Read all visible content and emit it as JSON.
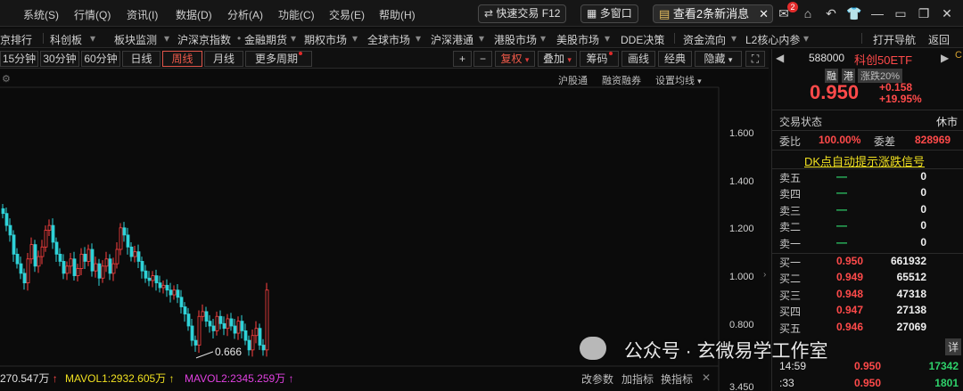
{
  "menubar": {
    "items": [
      "系统(S)",
      "行情(Q)",
      "资讯(I)",
      "数据(D)",
      "分析(A)",
      "功能(C)",
      "交易(E)",
      "帮助(H)"
    ],
    "quick_trade": "快速交易 F12",
    "multi_window": "多窗口",
    "news": "查看2条新消息",
    "mail_badge": "2"
  },
  "navbar": {
    "items": [
      "京排行",
      "科创板",
      "板块监测",
      "沪深京指数",
      "金融期货",
      "期权市场",
      "全球市场",
      "沪深港通",
      "港股市场",
      "美股市场",
      "DDE决策",
      "资金流向",
      "L2核心内参"
    ],
    "open_nav": "打开导航",
    "back": "返回"
  },
  "toolbar": {
    "periods": [
      "15分钟",
      "30分钟",
      "60分钟",
      "日线",
      "周线",
      "月线",
      "更多周期"
    ],
    "active_period": "周线",
    "right_buttons": [
      "+",
      "−",
      "复权",
      "叠加",
      "筹码",
      "画线",
      "经典",
      "隐藏"
    ]
  },
  "chart": {
    "sub_toolbar": [
      "沪股通",
      "融资融券",
      "设置均线"
    ],
    "y_ticks": [
      "1.600",
      "1.400",
      "1.200",
      "1.000",
      "0.800",
      "3.450"
    ],
    "low_annotation": "0.666",
    "volume_legend": {
      "vol": "270.547万",
      "mavol1": "MAVOL1:2932.605万",
      "mavol2": "MAVOL2:2345.259万"
    },
    "bottom_buttons": [
      "改参数",
      "加指标",
      "换指标"
    ],
    "colors": {
      "up": "#ff4040",
      "down": "#2fd3d8",
      "mavol1": "#f0e020",
      "mavol2": "#e040e0"
    }
  },
  "chart_data": {
    "type": "candlestick",
    "period": "周线",
    "ylim": [
      0.666,
      1.6
    ],
    "y_ticks": [
      1.6,
      1.4,
      1.2,
      1.0,
      0.8
    ],
    "closes": [
      1.27,
      1.22,
      1.18,
      1.1,
      1.06,
      1.02,
      0.98,
      1.08,
      1.14,
      1.05,
      1.09,
      1.13,
      1.2,
      1.22,
      1.15,
      1.1,
      1.07,
      1.02,
      1.05,
      1.08,
      1.01,
      1.04,
      1.1,
      1.07,
      1.12,
      1.03,
      1.06,
      1.0,
      1.05,
      1.08,
      1.02,
      1.06,
      1.12,
      1.21,
      1.18,
      1.13,
      1.09,
      1.11,
      1.07,
      1.03,
      1.0,
      0.99,
      1.01,
      0.98,
      0.96,
      0.97,
      0.95,
      0.93,
      0.95,
      0.92,
      0.88,
      0.85,
      0.8,
      0.74,
      0.72,
      0.84,
      0.86,
      0.82,
      0.8,
      0.78,
      0.84,
      0.81,
      0.79,
      0.83,
      0.8,
      0.77,
      0.82,
      0.78,
      0.74,
      0.7,
      0.76,
      0.79,
      0.72,
      0.7,
      0.95
    ],
    "last_close": 0.95
  },
  "quote": {
    "code": "588000",
    "name": "科创50ETF",
    "tag1": "融",
    "tag2": "港",
    "limit": "涨跌20%",
    "price": "0.950",
    "change": "+0.158",
    "change_pct": "+19.95%",
    "status_label": "交易状态",
    "status_value": "休市",
    "weibi_label": "委比",
    "weibi_value": "100.00%",
    "weicha_label": "委差",
    "weicha_value": "828969",
    "dk_signal": "DK点自动提示涨跌信号",
    "sells": [
      {
        "label": "卖五",
        "price": "—",
        "vol": "0"
      },
      {
        "label": "卖四",
        "price": "—",
        "vol": "0"
      },
      {
        "label": "卖三",
        "price": "—",
        "vol": "0"
      },
      {
        "label": "卖二",
        "price": "—",
        "vol": "0"
      },
      {
        "label": "卖一",
        "price": "—",
        "vol": "0"
      }
    ],
    "buys": [
      {
        "label": "买一",
        "price": "0.950",
        "vol": "661932"
      },
      {
        "label": "买二",
        "price": "0.949",
        "vol": "65512"
      },
      {
        "label": "买三",
        "price": "0.948",
        "vol": "47318"
      },
      {
        "label": "买四",
        "price": "0.947",
        "vol": "27138"
      },
      {
        "label": "买五",
        "price": "0.946",
        "vol": "27069"
      }
    ],
    "ticks": [
      {
        "time": "14:59",
        "price": "0.950",
        "vol": "17342"
      },
      {
        "time": ":33",
        "price": "0.950",
        "vol": "1801"
      }
    ],
    "detail_label": "详"
  },
  "watermark": "公众号 · 玄微易学工作室"
}
